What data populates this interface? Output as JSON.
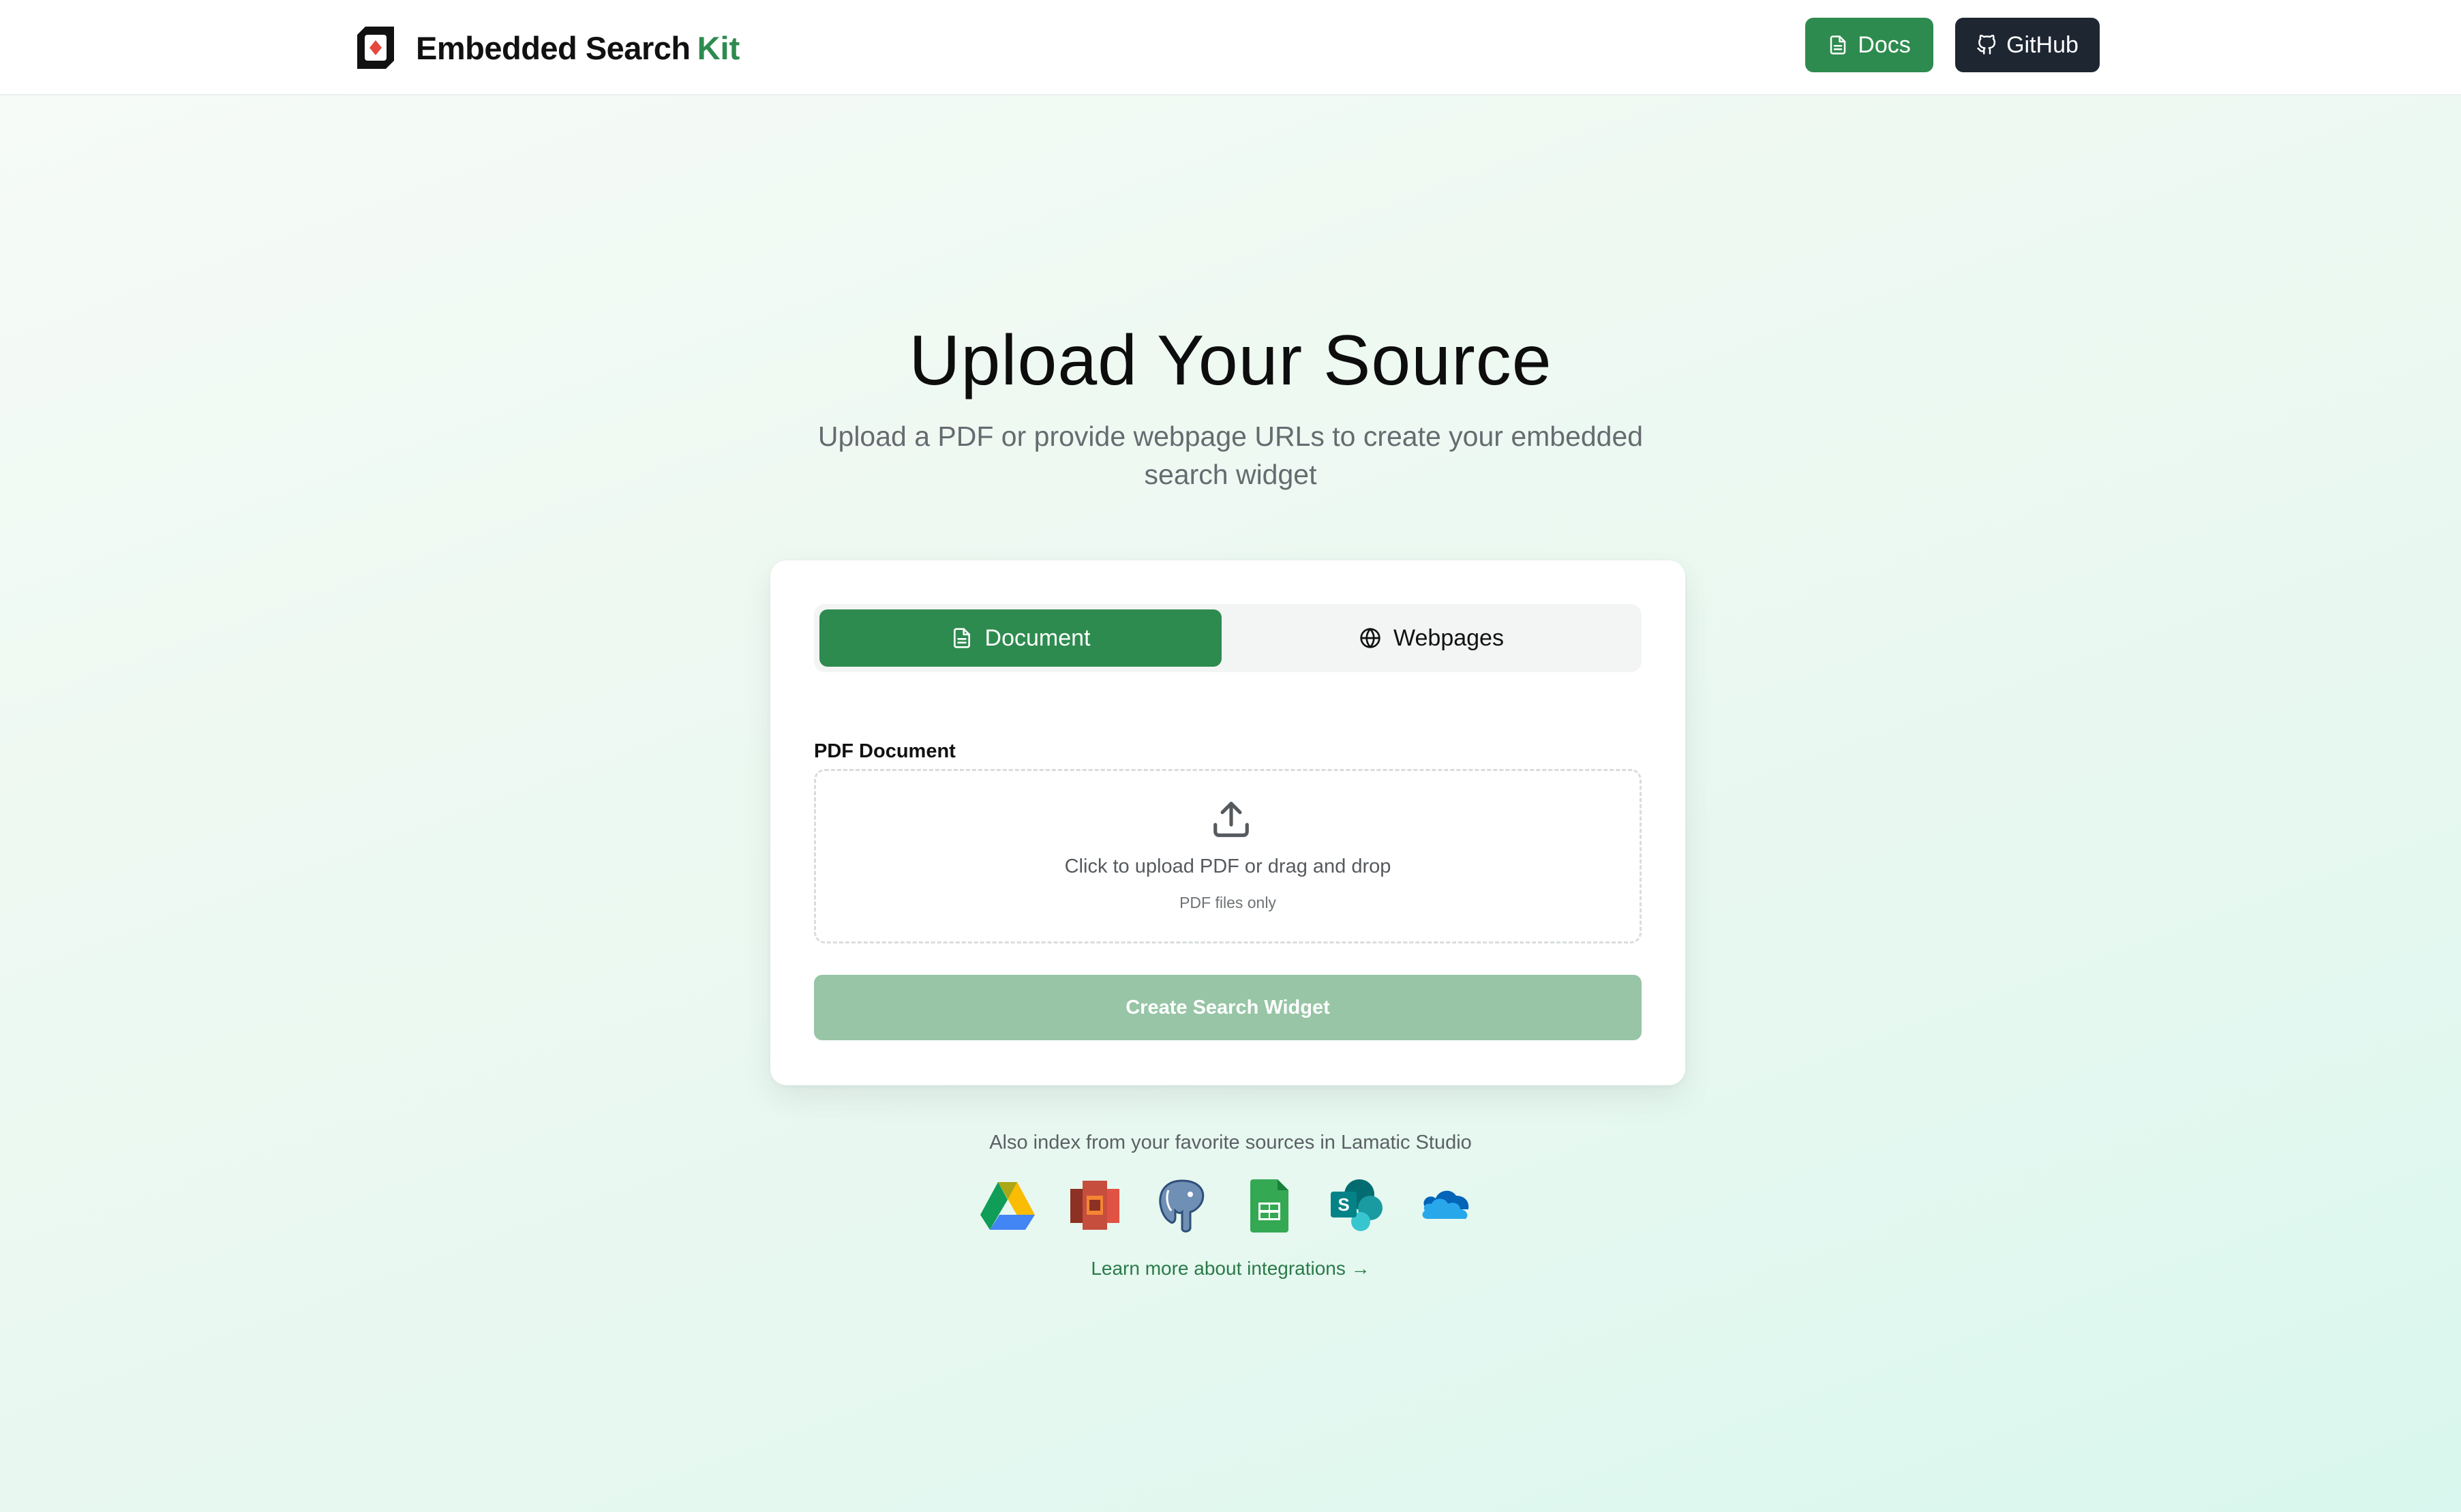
{
  "header": {
    "brand_name": "Embedded Search",
    "brand_accent": "Kit",
    "docs_label": "Docs",
    "github_label": "GitHub"
  },
  "hero": {
    "title": "Upload Your Source",
    "subtitle": "Upload a PDF or provide webpage URLs to create your embedded search widget"
  },
  "card": {
    "tabs": [
      {
        "label": "Document",
        "icon": "document-icon",
        "active": true
      },
      {
        "label": "Webpages",
        "icon": "globe-icon",
        "active": false
      }
    ],
    "field_label": "PDF Document",
    "dropzone": {
      "main_text": "Click to upload PDF or drag and drop",
      "hint_text": "PDF files only"
    },
    "submit_label": "Create Search Widget"
  },
  "integrations": {
    "caption": "Also index from your favorite sources in Lamatic Studio",
    "icons": [
      "google-drive-icon",
      "aws-s3-icon",
      "postgresql-icon",
      "google-sheets-icon",
      "sharepoint-icon",
      "onedrive-icon"
    ],
    "learn_more": "Learn more about integrations →"
  },
  "colors": {
    "accent": "#2e8b4f",
    "dark": "#1e2632",
    "disabled_button": "#97c5a6",
    "background": "#eef9f2"
  }
}
